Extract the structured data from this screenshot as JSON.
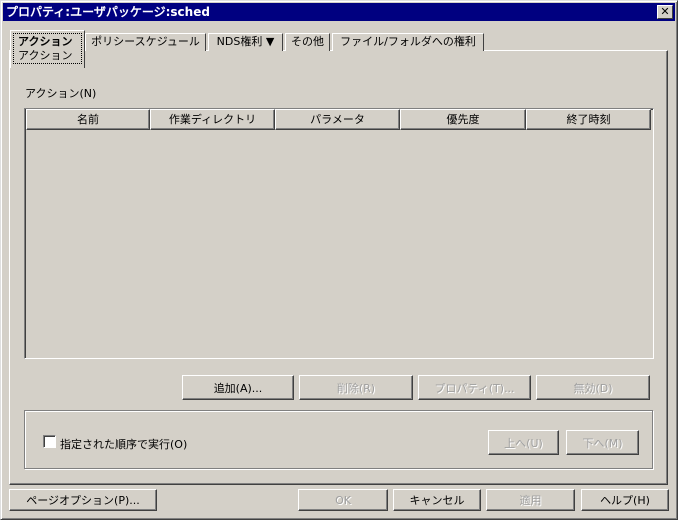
{
  "window": {
    "title": "プロパティ:ユーザパッケージ:sched",
    "close": "✕"
  },
  "tabs": [
    {
      "label": "アクション",
      "sublabel": "アクション",
      "active": true
    },
    {
      "label": "ポリシースケジュール"
    },
    {
      "label": "NDS権利 ▼"
    },
    {
      "label": "その他"
    },
    {
      "label": "ファイル/フォルダへの権利"
    }
  ],
  "actions": {
    "label": "アクション(N)",
    "columns": [
      "名前",
      "作業ディレクトリ",
      "パラメータ",
      "優先度",
      "終了時刻"
    ],
    "rows": []
  },
  "buttons": {
    "add": "追加(A)...",
    "delete": "削除(R)",
    "properties": "プロパティ(T)...",
    "disable": "無効(D)"
  },
  "order": {
    "checkbox_label": "指定された順序で実行(O)",
    "checked": false,
    "up": "上へ(U)",
    "down": "下へ(M)"
  },
  "footer": {
    "page_options": "ページオプション(P)...",
    "ok": "OK",
    "cancel": "キャンセル",
    "apply": "適用",
    "help": "ヘルプ(H)"
  }
}
